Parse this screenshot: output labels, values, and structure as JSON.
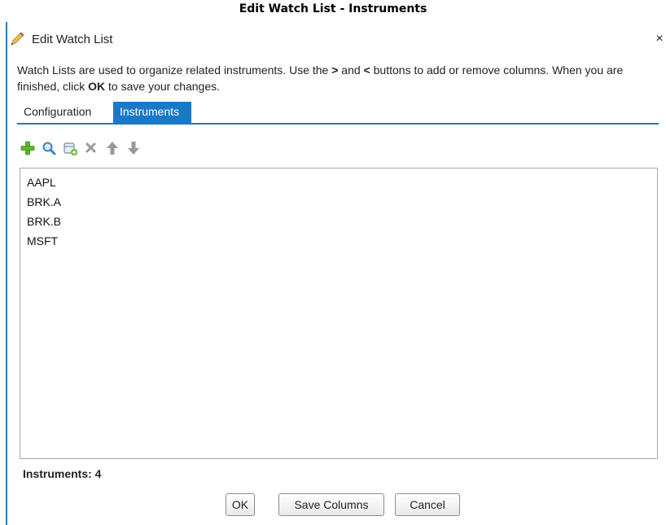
{
  "page_caption": "Edit Watch List - Instruments",
  "dialog": {
    "title": "Edit Watch List",
    "title_icon": "pencil-icon",
    "close_label": "×",
    "description": {
      "part1": "Watch Lists are used to organize related instruments. Use the ",
      "gt": ">",
      "part2": " and ",
      "lt": "<",
      "part3": " buttons to add or remove columns. When you are finished, click ",
      "ok": "OK",
      "part4": " to save your changes."
    }
  },
  "tabs": [
    {
      "label": "Configuration",
      "active": false
    },
    {
      "label": "Instruments",
      "active": true
    }
  ],
  "toolbar": {
    "buttons": [
      {
        "icon": "add-icon",
        "color": "#5cb82a"
      },
      {
        "icon": "search-icon",
        "color": "#3a86c8"
      },
      {
        "icon": "database-add-icon",
        "color": "#7a8a99"
      },
      {
        "icon": "delete-icon",
        "color": "#9a9a9a"
      },
      {
        "icon": "move-up-icon",
        "color": "#9a9a9a"
      },
      {
        "icon": "move-down-icon",
        "color": "#9a9a9a"
      }
    ]
  },
  "instruments": [
    "AAPL",
    "BRK.A",
    "BRK.B",
    "MSFT"
  ],
  "footer": {
    "count_label": "Instruments: 4"
  },
  "buttons": {
    "ok": "OK",
    "save_columns": "Save Columns",
    "cancel": "Cancel"
  },
  "colors": {
    "accent": "#1a78c9",
    "dialog_border": "#2b7bc2"
  }
}
